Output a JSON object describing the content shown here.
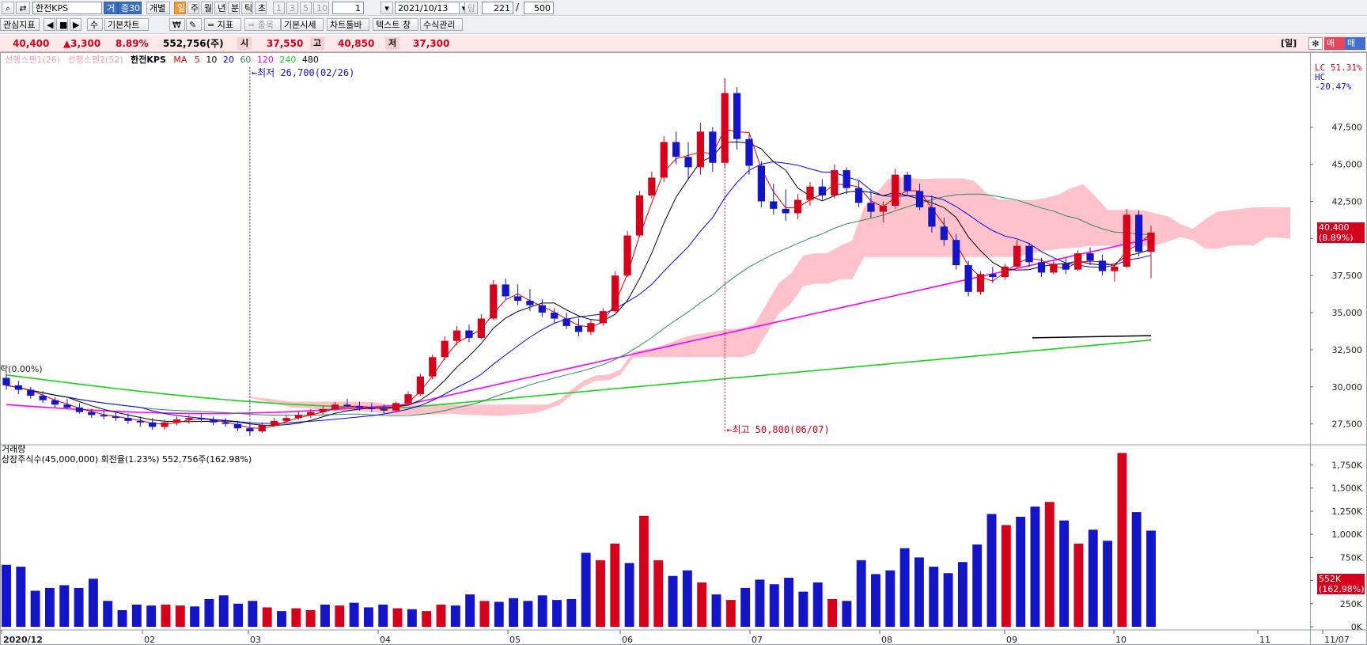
{
  "toolbar": {
    "stock_name": "한전KPS",
    "badge_1": "거",
    "badge_2": "증30",
    "individual": "개별",
    "periods": [
      "일",
      "주",
      "월",
      "년",
      "분",
      "틱",
      "초"
    ],
    "nums": [
      "1",
      "3",
      "5",
      "10"
    ],
    "interval_value": "1",
    "date": "2021/10/13",
    "date_suffix": "당",
    "count": "221",
    "slash": "/",
    "total": "500"
  },
  "toolbar2": {
    "watch_indicator": "관심지표",
    "basic_chart": "기본차트",
    "won": "₩",
    "indicator": "= 지표",
    "item": "= 종목",
    "basic_quote": "기본시세",
    "chart_toolbar": "차트툴바",
    "text_window": "텍스트 창",
    "formula": "수식관리",
    "nav": [
      "◀",
      "■",
      "▶",
      "수"
    ]
  },
  "quote": {
    "price": "40,400",
    "change": "▲3,300",
    "change_rate": "8.89%",
    "volume": "552,756(주)",
    "open_label": "시",
    "open": "37,550",
    "high_label": "고",
    "high": "40,850",
    "low_label": "저",
    "low": "37,300",
    "day_label": "[일]",
    "buy": "매수",
    "sell": "매도"
  },
  "legend": {
    "span1": "선행스팬1(26)",
    "span2": "선행스팬2(52)",
    "name": "한전KPS",
    "ma_label": "MA",
    "ma": [
      "5",
      "10",
      "20",
      "60",
      "120",
      "240",
      "480"
    ]
  },
  "colors": {
    "up": "#d6001c",
    "down": "#1414c8",
    "ma5": "#e00000",
    "ma10": "#000000",
    "ma20": "#0000ff",
    "ma60": "#2e8b57",
    "ma120": "#ff00ff",
    "ma240": "#19d219",
    "ma480": "#000000",
    "cloud": "#ffb6c1"
  },
  "right_panel": {
    "lc": "LC  51.31%",
    "hc": "HC -20.47%",
    "price_tag": "40,400",
    "price_tag_pct": "(8.89%)",
    "vol_tag": "552K",
    "vol_tag_pct": "(162.98%)"
  },
  "annotations": {
    "low": "←최저 26,700(02/26)",
    "high": "←최고 50,800(06/07)",
    "left_label": "락(0.00%)"
  },
  "volume_panel": {
    "title": "거래량",
    "info": "상장주식수(45,000,000) 회전율(1.23%) 552,756주(162.98%)"
  },
  "chart_data": [
    {
      "type": "candlestick",
      "title": "한전KPS",
      "x_tick_labels": [
        "2020/12",
        "02",
        "03",
        "04",
        "05",
        "06",
        "07",
        "08",
        "09",
        "10",
        "11",
        "11/07"
      ],
      "y_ticks": [
        27500,
        30000,
        32500,
        35000,
        37500,
        40000,
        42500,
        45000,
        47500
      ],
      "ylim": [
        26200,
        51700
      ],
      "ohlc_approx": [
        [
          30600,
          30900,
          29800,
          30100
        ],
        [
          30100,
          30400,
          29500,
          29800
        ],
        [
          29800,
          30000,
          29200,
          29400
        ],
        [
          29400,
          29700,
          28900,
          29100
        ],
        [
          29100,
          29300,
          28600,
          28800
        ],
        [
          28800,
          29200,
          28500,
          28600
        ],
        [
          28600,
          28900,
          28200,
          28300
        ],
        [
          28300,
          28500,
          27900,
          28100
        ],
        [
          28100,
          28400,
          27800,
          28000
        ],
        [
          28000,
          28300,
          27700,
          27900
        ],
        [
          27900,
          28200,
          27500,
          27700
        ],
        [
          27700,
          28000,
          27300,
          27600
        ],
        [
          27600,
          27900,
          27100,
          27300
        ],
        [
          27300,
          27800,
          27100,
          27600
        ],
        [
          27600,
          28000,
          27400,
          27800
        ],
        [
          27800,
          28100,
          27500,
          27900
        ],
        [
          27900,
          28200,
          27600,
          27800
        ],
        [
          27800,
          28000,
          27400,
          27600
        ],
        [
          27600,
          27900,
          27300,
          27500
        ],
        [
          27500,
          27700,
          27000,
          27200
        ],
        [
          27200,
          27500,
          26700,
          27000
        ],
        [
          27000,
          27600,
          26900,
          27400
        ],
        [
          27400,
          27900,
          27300,
          27700
        ],
        [
          27700,
          28100,
          27600,
          27900
        ],
        [
          27900,
          28300,
          27800,
          28100
        ],
        [
          28100,
          28500,
          27900,
          28300
        ],
        [
          28300,
          28700,
          28100,
          28500
        ],
        [
          28500,
          29000,
          28400,
          28800
        ],
        [
          28800,
          29200,
          28600,
          28700
        ],
        [
          28700,
          29000,
          28400,
          28600
        ],
        [
          28600,
          28900,
          28300,
          28500
        ],
        [
          28500,
          28800,
          28200,
          28400
        ],
        [
          28400,
          29000,
          28300,
          28900
        ],
        [
          28900,
          29700,
          28800,
          29500
        ],
        [
          29500,
          30900,
          29400,
          30700
        ],
        [
          30700,
          32200,
          30500,
          32000
        ],
        [
          32000,
          33400,
          31800,
          33100
        ],
        [
          33100,
          34100,
          32800,
          33800
        ],
        [
          33800,
          34200,
          33000,
          33300
        ],
        [
          33300,
          34900,
          33200,
          34600
        ],
        [
          34600,
          37200,
          34500,
          36900
        ],
        [
          36900,
          37300,
          35900,
          36100
        ],
        [
          36100,
          36900,
          35500,
          35800
        ],
        [
          35800,
          36600,
          35100,
          35500
        ],
        [
          35500,
          35900,
          34700,
          35000
        ],
        [
          35000,
          35300,
          34300,
          34600
        ],
        [
          34600,
          35000,
          33900,
          34100
        ],
        [
          34100,
          34600,
          33400,
          33700
        ],
        [
          33700,
          34500,
          33500,
          34300
        ],
        [
          34300,
          35300,
          34100,
          35100
        ],
        [
          35100,
          37800,
          35000,
          37500
        ],
        [
          37500,
          40500,
          37400,
          40200
        ],
        [
          40200,
          43200,
          40100,
          42900
        ],
        [
          42900,
          44500,
          42700,
          44100
        ],
        [
          44100,
          46900,
          43800,
          46500
        ],
        [
          46500,
          47200,
          45000,
          45500
        ],
        [
          45500,
          46500,
          44000,
          44800
        ],
        [
          44800,
          47800,
          44300,
          47200
        ],
        [
          47200,
          47500,
          44500,
          45100
        ],
        [
          45100,
          50800,
          44800,
          49800
        ],
        [
          49800,
          50200,
          46000,
          46700
        ],
        [
          46700,
          47000,
          44300,
          44900
        ],
        [
          44900,
          45200,
          42100,
          42500
        ],
        [
          42500,
          43700,
          41600,
          42000
        ],
        [
          42000,
          43300,
          41200,
          41700
        ],
        [
          41700,
          43000,
          41300,
          42600
        ],
        [
          42600,
          43800,
          42200,
          43500
        ],
        [
          43500,
          44000,
          42600,
          42900
        ],
        [
          42900,
          45000,
          42700,
          44600
        ],
        [
          44600,
          44800,
          43000,
          43400
        ],
        [
          43400,
          43900,
          42100,
          42400
        ],
        [
          42400,
          43200,
          41400,
          41800
        ],
        [
          41800,
          42500,
          41100,
          42200
        ],
        [
          42200,
          44700,
          42000,
          44300
        ],
        [
          44300,
          44500,
          42900,
          43200
        ],
        [
          43200,
          43700,
          41900,
          42100
        ],
        [
          42100,
          42900,
          40400,
          40800
        ],
        [
          40800,
          41400,
          39500,
          39900
        ],
        [
          39900,
          40300,
          37900,
          38200
        ],
        [
          38200,
          38500,
          36100,
          36400
        ],
        [
          36400,
          37800,
          36200,
          37600
        ],
        [
          37600,
          38100,
          37000,
          37400
        ],
        [
          37400,
          38300,
          37200,
          38100
        ],
        [
          38100,
          39900,
          38000,
          39500
        ],
        [
          39500,
          39700,
          38100,
          38400
        ],
        [
          38400,
          38700,
          37400,
          37700
        ],
        [
          37700,
          38500,
          37600,
          38300
        ],
        [
          38300,
          38700,
          37600,
          37900
        ],
        [
          37900,
          39200,
          37800,
          39000
        ],
        [
          39000,
          39400,
          38200,
          38500
        ],
        [
          38500,
          38900,
          37500,
          37800
        ],
        [
          37800,
          38300,
          37100,
          38100
        ],
        [
          38100,
          42000,
          38000,
          41600
        ],
        [
          41600,
          41900,
          38800,
          39100
        ],
        [
          39100,
          40850,
          37300,
          40400
        ]
      ],
      "moving_averages": [
        "MA5",
        "MA10",
        "MA20",
        "MA60",
        "MA120",
        "MA240",
        "MA480"
      ],
      "ichimoku": [
        "선행스팬1(26)",
        "선행스팬2(52)"
      ]
    },
    {
      "type": "bar",
      "title": "거래량",
      "y_ticks": [
        "0K",
        "250K",
        "500K",
        "750K",
        "1,000K",
        "1,250K",
        "1,500K",
        "1,750K"
      ],
      "ylim": [
        0,
        1900000
      ],
      "values_approx": [
        670,
        650,
        390,
        420,
        450,
        420,
        520,
        280,
        180,
        240,
        230,
        240,
        230,
        220,
        300,
        340,
        250,
        280,
        210,
        170,
        200,
        180,
        240,
        230,
        260,
        210,
        240,
        200,
        190,
        170,
        240,
        230,
        350,
        280,
        270,
        310,
        280,
        340,
        290,
        300,
        800,
        720,
        900,
        690,
        1200,
        720,
        550,
        610,
        480,
        350,
        290,
        420,
        510,
        460,
        530,
        380,
        480,
        300,
        280,
        720,
        570,
        610,
        850,
        750,
        650,
        580,
        700,
        890,
        1220,
        1100,
        1190,
        1300,
        1350,
        1150,
        900,
        1050,
        930,
        1880,
        1240,
        1040
      ]
    }
  ]
}
